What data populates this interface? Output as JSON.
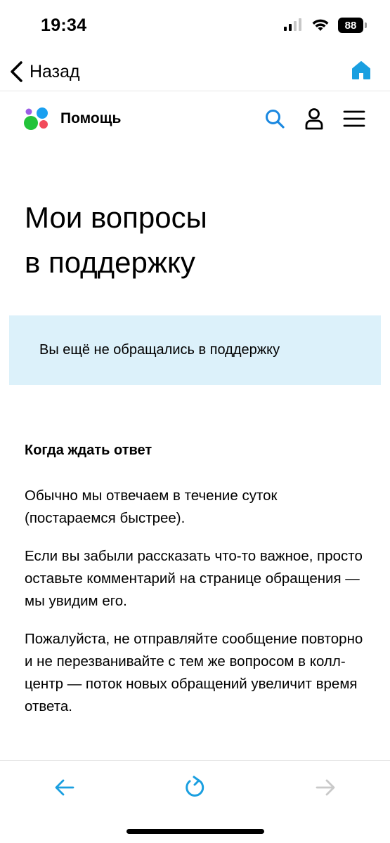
{
  "status_bar": {
    "time": "19:34",
    "battery": "88",
    "icons": [
      "signal-icon",
      "wifi-icon",
      "battery-icon"
    ]
  },
  "nav_bar": {
    "back_label": "Назад",
    "icons": [
      "chevron-left-icon",
      "home-icon"
    ],
    "accent_color": "#1a9fe0"
  },
  "site_header": {
    "title": "Помощь",
    "icons": [
      "logo-icon",
      "search-icon",
      "user-icon",
      "menu-icon"
    ],
    "logo_colors": [
      "#9b5de5",
      "#1aa0f0",
      "#23c33a",
      "#f24a5a"
    ]
  },
  "main": {
    "title_line1": "Мои вопросы",
    "title_line2": "в поддержку",
    "notice": {
      "text": "Вы ещё не обращались в поддержку",
      "background": "#dcf1fa"
    },
    "section_title": "Когда ждать ответ",
    "paragraphs": [
      "Обычно мы отвечаем в течение суток (постараемся быстрее).",
      "Если вы забыли рассказать что-то важное, просто оставьте комментарий на странице обращения — мы увидим его.",
      "Пожалуйста, не отправляйте сообщение повторно и не перезванивайте с тем же вопросом в колл-центр — поток новых обращений увеличит время ответа."
    ]
  },
  "toolbar": {
    "icons": [
      "arrow-left-icon",
      "reload-icon",
      "arrow-right-icon"
    ]
  }
}
